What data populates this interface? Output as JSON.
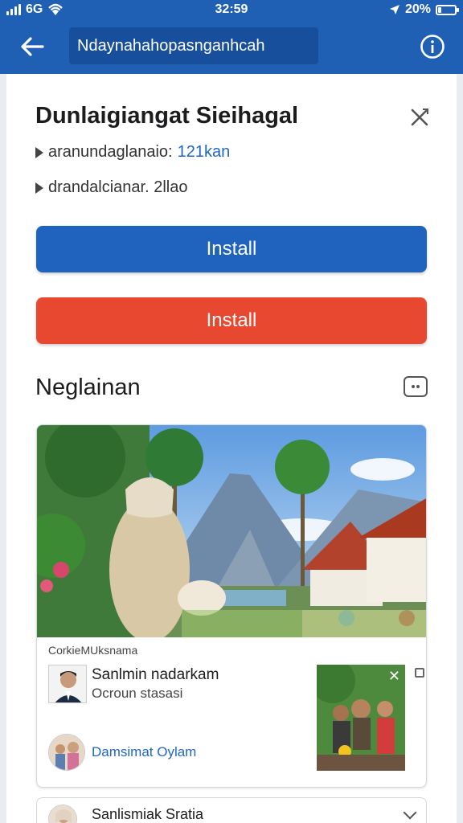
{
  "status_bar": {
    "carrier": "6G",
    "time": "32:59",
    "battery": "20%",
    "battery_level": 0.2
  },
  "app_bar": {
    "url": "Ndaynahahopasnganhcah"
  },
  "app_info": {
    "title": "Dunlaigiangat Sieihagal",
    "meta1_label": "aranundaglanaio:",
    "meta1_value": "121kan",
    "meta2": "drandalcianar. 2llao"
  },
  "buttons": {
    "primary_install": "Install",
    "secondary_install": "Install"
  },
  "section": {
    "title": "Neglainan"
  },
  "card": {
    "caption": "CorkieMUksnama",
    "author_name": "Sanlmin nadarkam",
    "author_sub": "Ocroun stasasi",
    "link": "Damsimat Oylam"
  },
  "card2": {
    "name": "Sanlismiak Sratia"
  },
  "colors": {
    "header": "#1f5fb4",
    "primary_button": "#1f63bf",
    "secondary_button": "#e7482f",
    "link": "#1f66c4"
  },
  "icons": {
    "back": "back-arrow-icon",
    "info": "info-icon",
    "close": "close-icon",
    "section": "ellipsis-box-icon"
  }
}
